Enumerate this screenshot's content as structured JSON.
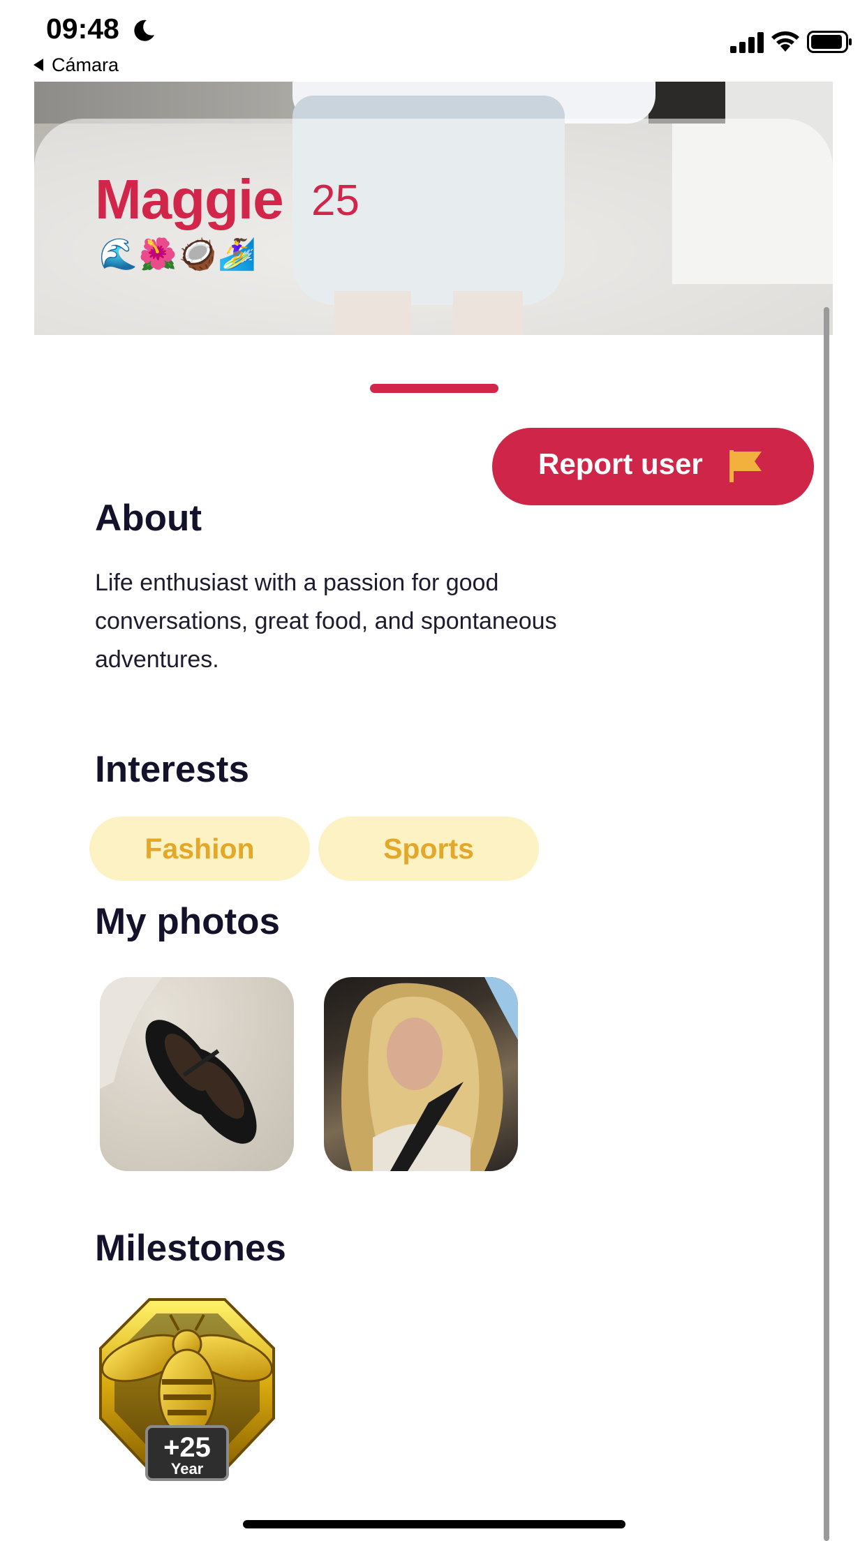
{
  "status_bar": {
    "time": "09:48",
    "back_app": "Cámara"
  },
  "profile": {
    "name": "Maggie",
    "age": "25",
    "emojis": "🌊🌺🥥🏄‍♀️"
  },
  "report_button": {
    "label": "Report user"
  },
  "about": {
    "title": "About",
    "text": "Life enthusiast with a passion for good conversations, great food, and spontaneous adventures."
  },
  "interests": {
    "title": "Interests",
    "items": [
      "Fashion",
      "Sports"
    ]
  },
  "photos": {
    "title": "My photos"
  },
  "milestones": {
    "title": "Milestones",
    "badge_value": "+25",
    "badge_unit": "Year"
  },
  "colors": {
    "accent": "#d1264a",
    "chip_bg": "#fdf2c4",
    "chip_text": "#e3a82a",
    "heading": "#14122b"
  }
}
